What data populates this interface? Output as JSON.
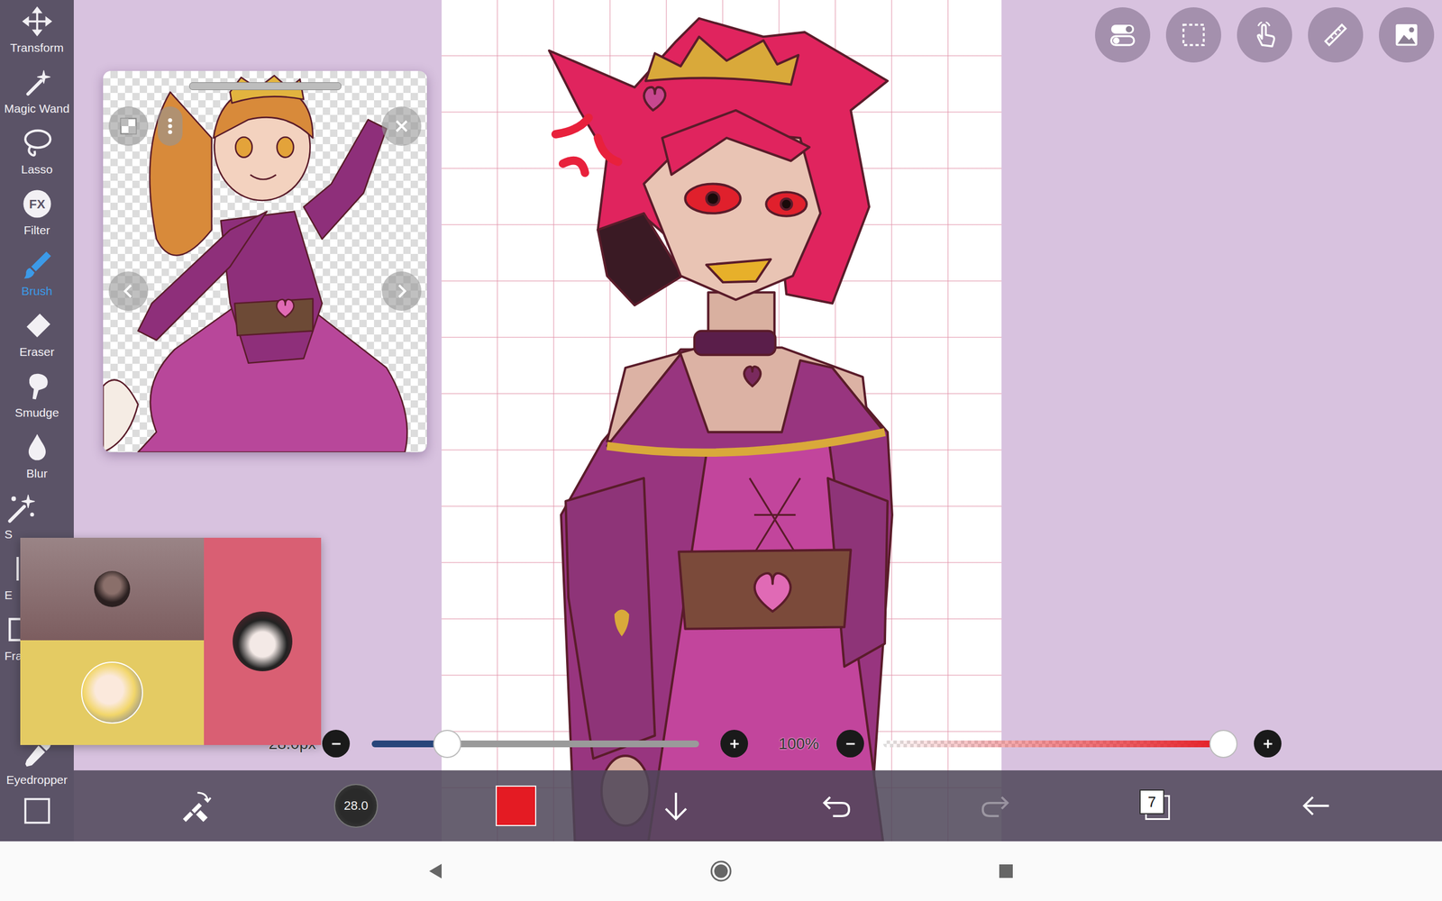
{
  "toolbar": {
    "items": [
      {
        "label": "Transform",
        "selected": false,
        "kind": "full"
      },
      {
        "label": "Magic Wand",
        "selected": false,
        "kind": "full"
      },
      {
        "label": "Lasso",
        "selected": false,
        "kind": "full"
      },
      {
        "label": "Filter",
        "selected": false,
        "kind": "full"
      },
      {
        "label": "Brush",
        "selected": true,
        "kind": "full"
      },
      {
        "label": "Eraser",
        "selected": false,
        "kind": "full"
      },
      {
        "label": "Smudge",
        "selected": false,
        "kind": "full"
      },
      {
        "label": "Blur",
        "selected": false,
        "kind": "full"
      },
      {
        "label": "S",
        "selected": false,
        "kind": "cut"
      },
      {
        "label": "E",
        "selected": false,
        "kind": "cut"
      },
      {
        "label": "Fra",
        "selected": false,
        "kind": "cut"
      }
    ],
    "bottom_items": [
      {
        "label": "Eyedropper",
        "selected": false,
        "kind": "full"
      }
    ]
  },
  "filter_badge": "FX",
  "brush_size_slider": {
    "reading": "28.0px",
    "level": 0.23
  },
  "opacity_slider": {
    "reading": "100%",
    "level": 1
  },
  "bottom_bar": {
    "brush_size": "28.0",
    "current_color": "#e41b23",
    "layer_count": "7",
    "redo_disabled": true
  }
}
